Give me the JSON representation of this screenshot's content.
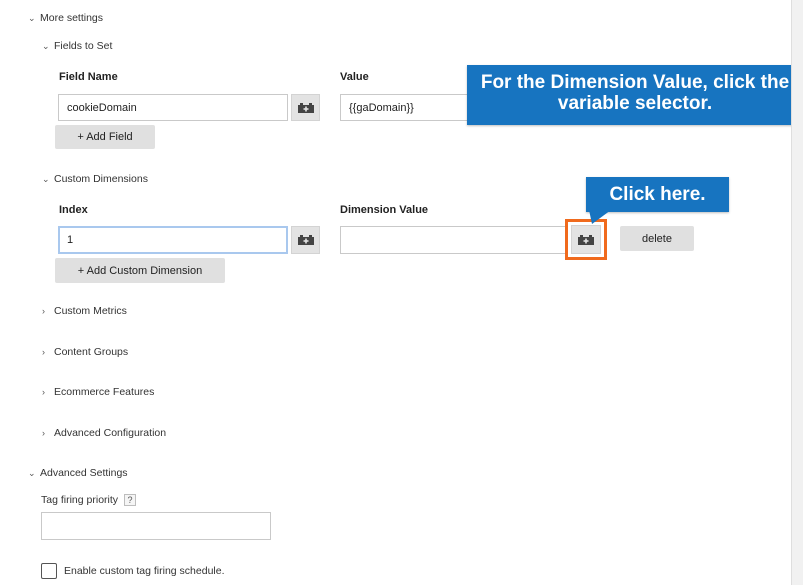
{
  "sections": {
    "more_settings": "More settings",
    "fields_to_set": "Fields to Set",
    "custom_dimensions": "Custom Dimensions",
    "custom_metrics": "Custom Metrics",
    "content_groups": "Content Groups",
    "ecommerce_features": "Ecommerce Features",
    "advanced_configuration": "Advanced Configuration",
    "advanced_settings": "Advanced Settings"
  },
  "fields_to_set": {
    "col_field_name": "Field Name",
    "col_value": "Value",
    "field_name_value": "cookieDomain",
    "value_value": "{{gaDomain}}",
    "add_field_label": "+ Add Field"
  },
  "custom_dimensions": {
    "col_index": "Index",
    "col_dimension_value": "Dimension Value",
    "index_value": "1",
    "dimension_value": "",
    "delete_label": "delete",
    "add_dimension_label": "+ Add Custom Dimension"
  },
  "advanced_settings": {
    "tag_firing_priority_label": "Tag firing priority",
    "help_mark": "?",
    "tag_firing_priority_value": "",
    "custom_schedule_label": "Enable custom tag firing schedule.",
    "custom_schedule_checked": false
  },
  "callouts": {
    "dimension_value_tip": "For the Dimension Value, click the variable selector.",
    "click_here": "Click here."
  },
  "icons": {
    "chevron_down": "chevron-down-icon",
    "chevron_right": "chevron-right-icon",
    "variable_selector": "variable-selector-icon"
  },
  "colors": {
    "callout_blue": "#1774c0",
    "highlight_orange": "#f06a1d",
    "focus_blue": "#a9c8ee"
  }
}
